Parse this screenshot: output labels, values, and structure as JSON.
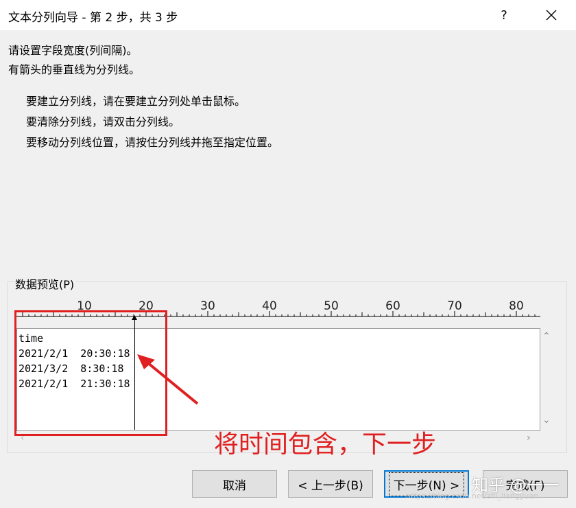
{
  "window": {
    "title": "文本分列向导 - 第 2 步，共 3 步",
    "help": "?"
  },
  "instructions": {
    "line1": "请设置字段宽度(列间隔)。",
    "line2": "有箭头的垂直线为分列线。",
    "tip1": "要建立分列线，请在要建立分列处单击鼠标。",
    "tip2": "要清除分列线，请双击分列线。",
    "tip3": "要移动分列线位置，请按住分列线并拖至指定位置。"
  },
  "preview": {
    "label": "数据预览(P)",
    "ruler": [
      "10",
      "20",
      "30",
      "40",
      "50",
      "60",
      "70",
      "80"
    ],
    "rows": [
      "time",
      "2021/2/1  20:30:18",
      "2021/3/2  8:30:18",
      "2021/2/1  21:30:18"
    ]
  },
  "annotation": {
    "text": "将时间包含，下一步",
    "color": "#e02020"
  },
  "buttons": {
    "cancel": "取消",
    "back": "< 上一步(B)",
    "next": "下一步(N) >",
    "finish": "完成(F)"
  },
  "watermark": {
    "brand": "知乎 @一一",
    "url": "https://blog.csdn.net/zhi_liangyuan"
  }
}
